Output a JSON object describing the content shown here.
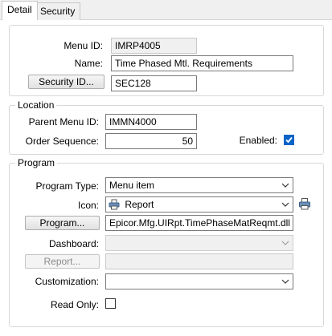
{
  "tabs": {
    "detail": "Detail",
    "security": "Security"
  },
  "header": {
    "menu_id_label": "Menu ID:",
    "menu_id_value": "IMRP4005",
    "name_label": "Name:",
    "name_value": "Time Phased Mtl. Requirements",
    "security_id_button": "Security ID...",
    "security_id_value": "SEC128"
  },
  "location": {
    "title": "Location",
    "parent_menu_label": "Parent Menu ID:",
    "parent_menu_value": "IMMN4000",
    "order_sequence_label": "Order Sequence:",
    "order_sequence_value": "50",
    "enabled_label": "Enabled:",
    "enabled_checked": true
  },
  "program": {
    "title": "Program",
    "program_type_label": "Program Type:",
    "program_type_value": "Menu item",
    "icon_label": "Icon:",
    "icon_value": "Report",
    "program_button": "Program...",
    "program_value": "Epicor.Mfg.UIRpt.TimePhaseMatReqmt.dll",
    "dashboard_label": "Dashboard:",
    "dashboard_value": "",
    "report_button": "Report...",
    "report_value": "",
    "customization_label": "Customization:",
    "customization_value": "",
    "read_only_label": "Read Only:",
    "read_only_checked": false
  },
  "icons": {
    "dropdown": "chevron-down-icon",
    "printer": "printer-icon",
    "check": "checkmark-icon"
  },
  "colors": {
    "accent": "#0a64c8",
    "border": "#7a7a7a"
  }
}
